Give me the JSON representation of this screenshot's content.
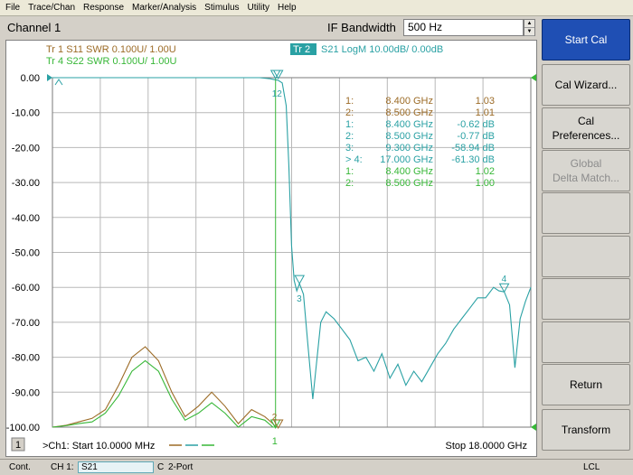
{
  "menu": [
    "File",
    "Trace/Chan",
    "Response",
    "Marker/Analysis",
    "Stimulus",
    "Utility",
    "Help"
  ],
  "toolbar": {
    "channel_title": "Channel 1",
    "param_label": "IF Bandwidth",
    "param_value": "500 Hz",
    "spin_up": "▲",
    "spin_down": "▼"
  },
  "traces": [
    {
      "text": "Tr  1  S11  SWR  0.100U/  1.00U",
      "color": "#9c6b26"
    },
    {
      "text": "Tr  4  S22  SWR  0.100U/  1.00U",
      "color": "#37b737"
    },
    {
      "id": "Tr  2",
      "text": "S21  LogM  10.00dB/  0.00dB",
      "color": "#2aa1a4"
    }
  ],
  "y_ticks": [
    "0.00",
    "-10.00",
    "-20.00",
    "-30.00",
    "-40.00",
    "-50.00",
    "-60.00",
    "-70.00",
    "-80.00",
    "-90.00",
    "-100.00"
  ],
  "markers_table": [
    {
      "id": "1:",
      "freq": "8.400 GHz",
      "val": "1.03",
      "color": "#9c6b26"
    },
    {
      "id": "2:",
      "freq": "8.500 GHz",
      "val": "1.01",
      "color": "#9c6b26"
    },
    {
      "id": "1:",
      "freq": "8.400 GHz",
      "val": "-0.62 dB",
      "color": "#2aa1a4"
    },
    {
      "id": "2:",
      "freq": "8.500 GHz",
      "val": "-0.77 dB",
      "color": "#2aa1a4"
    },
    {
      "id": "3:",
      "freq": "9.300 GHz",
      "val": "-58.94 dB",
      "color": "#2aa1a4"
    },
    {
      "id": "> 4:",
      "freq": "17.000 GHz",
      "val": "-61.30 dB",
      "color": "#2aa1a4"
    },
    {
      "id": "1:",
      "freq": "8.400 GHz",
      "val": "1.02",
      "color": "#37b737"
    },
    {
      "id": "2:",
      "freq": "8.500 GHz",
      "val": "1.00",
      "color": "#37b737"
    }
  ],
  "marker_labels": {
    "m12": "12",
    "m3": "3",
    "m4": "4",
    "m1": "1",
    "m2_bottom": "2"
  },
  "footer": {
    "channel_num": "1",
    "start": ">Ch1: Start  10.0000 MHz",
    "stop": "Stop  18.0000 GHz"
  },
  "softkeys": [
    {
      "lines": [
        "Start Cal"
      ],
      "state": "active"
    },
    {
      "lines": [
        "Cal Wizard..."
      ],
      "state": "normal"
    },
    {
      "lines": [
        "Cal",
        "Preferences..."
      ],
      "state": "normal"
    },
    {
      "lines": [
        "Global",
        "Delta Match..."
      ],
      "state": "disabled"
    },
    {
      "lines": [
        ""
      ],
      "state": "normal"
    },
    {
      "lines": [
        ""
      ],
      "state": "normal"
    },
    {
      "lines": [
        ""
      ],
      "state": "normal"
    },
    {
      "lines": [
        ""
      ],
      "state": "normal"
    },
    {
      "lines": [
        "Return"
      ],
      "state": "normal"
    },
    {
      "lines": [
        "Transform"
      ],
      "state": "normal"
    }
  ],
  "status": {
    "mode": "Cont.",
    "ch": "CH 1:",
    "meas": "S21",
    "cal": "C",
    "port": "2-Port",
    "ref": "LCL"
  },
  "chart_data": {
    "type": "line",
    "xlim": [
      0.01,
      18.0
    ],
    "ylim": [
      -100,
      0
    ],
    "series": [
      {
        "name": "S21",
        "color": "#2aa1a4",
        "x": [
          0.01,
          7.8,
          8.2,
          8.4,
          8.5,
          8.65,
          8.8,
          8.9,
          9.0,
          9.1,
          9.2,
          9.3,
          9.45,
          9.6,
          9.8,
          10.1,
          10.3,
          10.6,
          10.9,
          11.2,
          11.5,
          11.8,
          12.1,
          12.4,
          12.7,
          13.0,
          13.3,
          13.6,
          13.9,
          14.2,
          14.5,
          14.8,
          15.1,
          15.4,
          15.7,
          16.0,
          16.3,
          16.6,
          16.8,
          17.0,
          17.2,
          17.4,
          17.6,
          17.8,
          18.0
        ],
        "y": [
          0,
          0,
          -0.3,
          -0.62,
          -0.77,
          -1.5,
          -8,
          -25,
          -48,
          -58,
          -61,
          -58.94,
          -62,
          -75,
          -92,
          -70,
          -67,
          -69,
          -72,
          -75,
          -81,
          -80,
          -84,
          -79,
          -86,
          -82,
          -88,
          -84,
          -87,
          -83,
          -79,
          -76,
          -72,
          -69,
          -66,
          -63,
          -63,
          -60,
          -61,
          -61.3,
          -65,
          -83,
          -69,
          -64,
          -60
        ]
      },
      {
        "name": "S11",
        "color": "#9c6b26",
        "x": [
          0.01,
          0.5,
          1.0,
          1.5,
          2.0,
          2.5,
          3.0,
          3.5,
          4.0,
          4.5,
          5.0,
          5.5,
          6.0,
          6.5,
          7.0,
          7.5,
          8.0,
          8.3,
          8.4
        ],
        "y": [
          -100,
          -99.5,
          -98.5,
          -97.5,
          -95,
          -88,
          -80,
          -77,
          -81,
          -90,
          -97,
          -94,
          -90,
          -94,
          -99,
          -95,
          -97,
          -99,
          -100
        ]
      },
      {
        "name": "S22",
        "color": "#37b737",
        "x": [
          0.01,
          0.5,
          1.0,
          1.5,
          2.0,
          2.5,
          3.0,
          3.5,
          4.0,
          4.5,
          5.0,
          5.5,
          6.0,
          6.5,
          7.0,
          7.5,
          8.0,
          8.3,
          8.4
        ],
        "y": [
          -100,
          -99.6,
          -99,
          -98.5,
          -96,
          -91,
          -84,
          -81,
          -84,
          -92,
          -98,
          -96,
          -93,
          -96,
          -100,
          -97,
          -98,
          -100,
          -100
        ]
      }
    ]
  }
}
